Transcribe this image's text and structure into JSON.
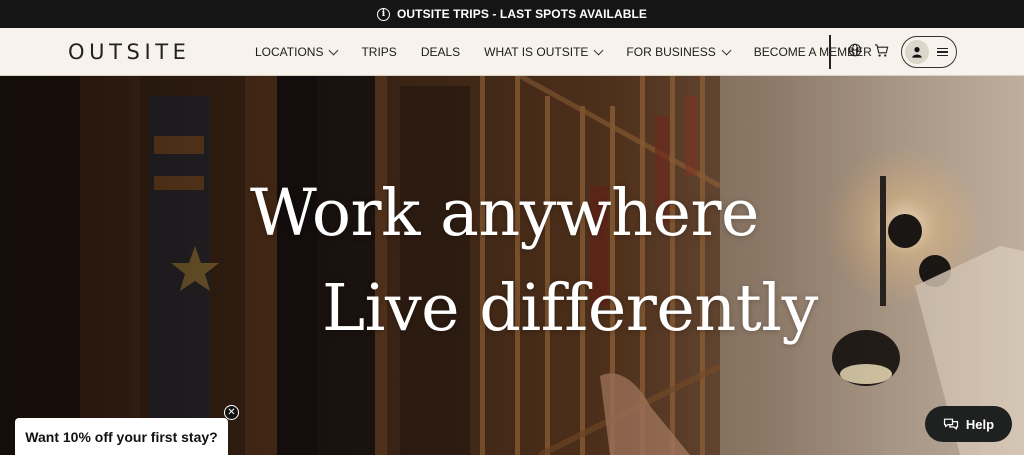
{
  "announcement": {
    "icon": "info-icon",
    "text": "OUTSITE TRIPS - LAST SPOTS AVAILABLE"
  },
  "nav": {
    "logo": "OUTSITE",
    "items": [
      {
        "label": "LOCATIONS",
        "dropdown": true
      },
      {
        "label": "TRIPS",
        "dropdown": false
      },
      {
        "label": "DEALS",
        "dropdown": false
      },
      {
        "label": "WHAT IS OUTSITE",
        "dropdown": true
      },
      {
        "label": "FOR BUSINESS",
        "dropdown": true
      },
      {
        "label": "BECOME A MEMBER",
        "dropdown": false
      }
    ],
    "icons": [
      "globe-icon",
      "cart-icon",
      "user-icon",
      "menu-icon"
    ]
  },
  "hero": {
    "line1": "Work anywhere",
    "line2": "Live differently"
  },
  "promo": {
    "text": "Want 10% off your first stay?",
    "close_icon": "close-icon"
  },
  "help": {
    "label": "Help",
    "icon": "chat-icon"
  },
  "colors": {
    "announcement_bg": "#151515",
    "nav_bg": "#f7f3ec",
    "help_bg": "#1f2020"
  }
}
